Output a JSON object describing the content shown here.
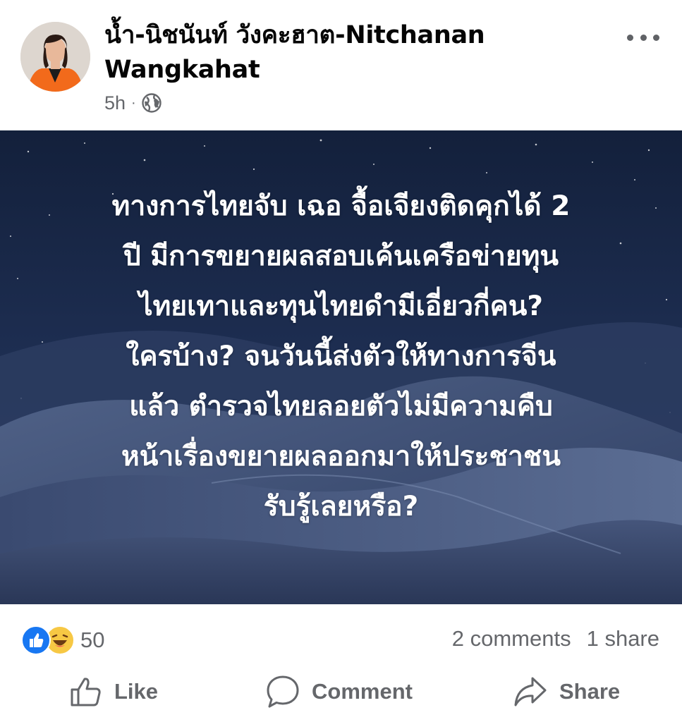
{
  "post": {
    "author_line1": "น้ำ-นิชนันท์ วังคะฮาต-Nitchanan",
    "author_line2": "Wangkahat",
    "time": "5h",
    "separator": "·",
    "privacy_icon": "globe-icon",
    "more_icon": "more-horizontal-icon",
    "image_text_lines": [
      "ทางการไทยจับ เฉอ จื้อเจียงติดคุกได้ 2",
      "ปี มีการขยายผลสอบเค้นเครือข่ายทุน",
      "ไทยเทาและทุนไทยดำมีเอี่ยวกี่คน?",
      "ใครบ้าง? จนวันนี้ส่งตัวให้ทางการจีน",
      "แล้ว ตำรวจไทยลอยตัวไม่มีความคืบ",
      "หน้าเรื่องขยายผลออกมาให้ประชาชน",
      "รับรู้เลยหรือ?"
    ]
  },
  "stats": {
    "reaction_icons": [
      "like-reaction-icon",
      "haha-reaction-icon"
    ],
    "reaction_count": "50",
    "comments": "2 comments",
    "shares": "1 share"
  },
  "actions": {
    "like_label": "Like",
    "comment_label": "Comment",
    "share_label": "Share"
  },
  "colors": {
    "secondary_text": "#65676b",
    "like_blue": "#1877f2",
    "haha_yellow": "#f7c844",
    "image_bg": "#1a2a4a"
  }
}
